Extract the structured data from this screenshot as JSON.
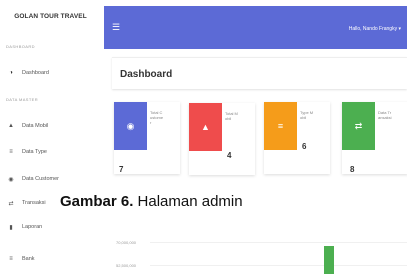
{
  "sidebar": {
    "brand": "GOLAN TOUR TRAVEL",
    "section_dashboard": "DASHBOARD",
    "section_master": "DATA MASTER",
    "items": [
      {
        "label": "Dashboard",
        "icon": "speedometer-icon"
      },
      {
        "label": "Data Mobil",
        "icon": "car-icon"
      },
      {
        "label": "Data Type",
        "icon": "list-icon"
      },
      {
        "label": "Data Customer",
        "icon": "users-icon"
      },
      {
        "label": "Transaksi",
        "icon": "transaction-icon"
      },
      {
        "label": "Laporan",
        "icon": "document-icon"
      },
      {
        "label": "Bank",
        "icon": "bank-icon"
      }
    ]
  },
  "topbar": {
    "menu_icon": "hamburger-icon",
    "user": "Hallo, Nando Frangky",
    "color": "#5c6ad6"
  },
  "main": {
    "title": "Dashboard",
    "cards": [
      {
        "label": "Total Customer",
        "value": "7",
        "color": "#5c6ad6",
        "icon": "users-icon"
      },
      {
        "label": "Total Mobil",
        "value": "4",
        "color": "#ef4c4c",
        "icon": "car-icon"
      },
      {
        "label": "Type Mobil",
        "value": "6",
        "color": "#f59c1a",
        "icon": "list-icon"
      },
      {
        "label": "Data Transaksi",
        "value": "8",
        "color": "#4caf50",
        "icon": "transaction-icon"
      }
    ]
  },
  "caption": {
    "label": "Gambar 6.",
    "text": " Halaman admin"
  },
  "chart_data": {
    "type": "bar",
    "ytick_labels": [
      "70,000,000",
      "52,500,000"
    ],
    "bar_color": "#4caf50"
  }
}
